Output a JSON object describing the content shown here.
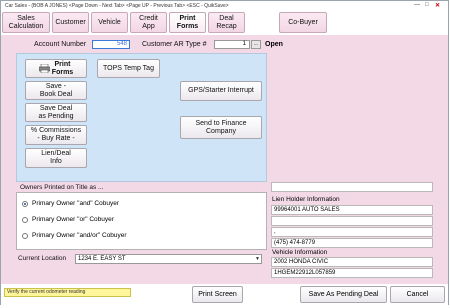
{
  "window": {
    "title": "Car Sales - (BOB A JONES) <Page Down - Next Tab> <Page UP - Previous Tab> <ESC - QuikSave>"
  },
  "tabs": [
    {
      "label": "Sales\nCalculation"
    },
    {
      "label": "Customer"
    },
    {
      "label": "Vehicle"
    },
    {
      "label": "Credit\nApp"
    },
    {
      "label": "Print\nForms",
      "active": true
    },
    {
      "label": "Deal\nRecap"
    },
    {
      "label": "Co-Buyer"
    }
  ],
  "header": {
    "account_label": "Account Number",
    "account_value": "548",
    "ar_type_label": "Customer AR Type #",
    "ar_type_value": "1",
    "ar_type_button": "...",
    "status": "Open"
  },
  "actions": {
    "print_forms": "Print\nForms",
    "save_book_deal": "Save -\nBook Deal",
    "save_deal_pending": "Save Deal\nas Pending",
    "commissions": "% Commissions\n- Buy Rate -",
    "lien_deal_info": "Lien/Deal\nInfo",
    "tops_temp_tag": "TOPS Temp Tag",
    "gps_starter": "GPS/Starter Interrupt",
    "send_to_finance": "Send to Finance\nCompany"
  },
  "owners": {
    "title": "Owners Printed on Title as ...",
    "options": [
      {
        "label": "Primary Owner \"and\" Cobuyer",
        "selected": true
      },
      {
        "label": "Primary Owner \"or\" Cobuyer",
        "selected": false
      },
      {
        "label": "Primary Owner \"and/or\" Cobuyer",
        "selected": false
      }
    ]
  },
  "location": {
    "label": "Current Location",
    "value": "1234 E. EASY ST"
  },
  "lien_holder": {
    "label": "Lien Holder Information",
    "lines": [
      "99964001 AUTO SALES",
      "",
      ", ",
      "(475) 474-8779"
    ]
  },
  "vehicle": {
    "label": "Vehicle Information",
    "lines": [
      "2002 HONDA CIVIC",
      "1HGEM22912L057859"
    ]
  },
  "status_message": "Verify the current odometer reading",
  "footer": {
    "print_screen": "Print Screen",
    "save_pending": "Save As Pending Deal",
    "cancel": "Cancel"
  },
  "colors": {
    "panel": "#f3d9e6",
    "blue_panel": "#cfe4f7",
    "status_highlight": "#fff59a"
  }
}
